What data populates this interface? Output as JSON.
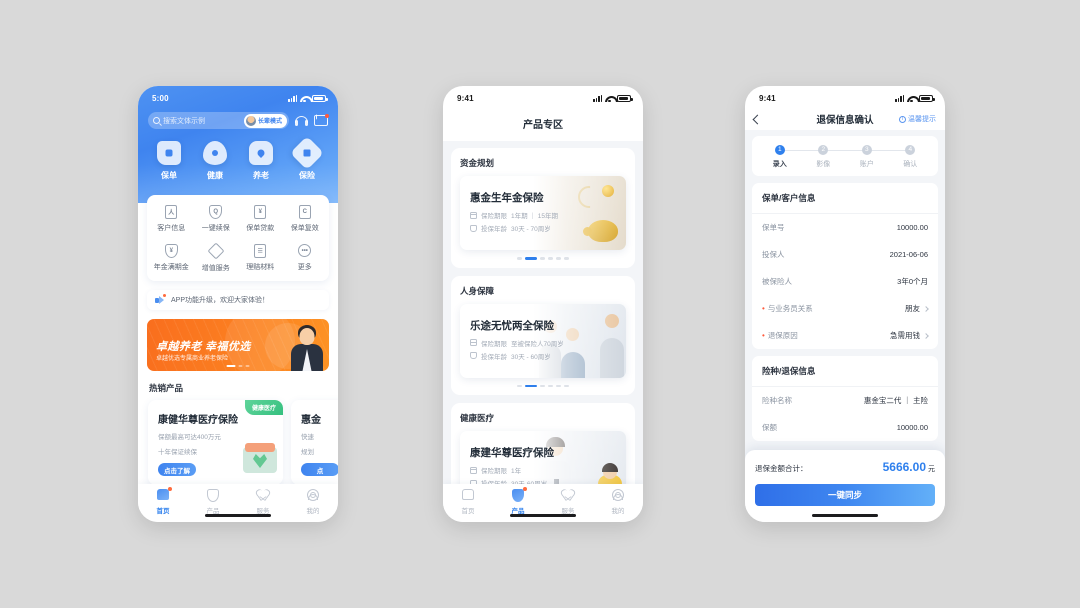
{
  "phone1": {
    "status": {
      "time": "5:00"
    },
    "search": {
      "placeholder": "搜索文体示例",
      "elder_mode": "长辈模式"
    },
    "icons": {
      "headphone": "headphone-icon",
      "mail": "mail-icon",
      "search": "search-icon"
    },
    "topnav": [
      {
        "label": "保单",
        "icon": "policy-icon"
      },
      {
        "label": "健康",
        "icon": "health-drop-icon"
      },
      {
        "label": "养老",
        "icon": "pension-house-icon"
      },
      {
        "label": "保险",
        "icon": "insurance-shield-icon"
      }
    ],
    "grid": [
      {
        "label": "客户信息",
        "icon": "user-card-icon",
        "glyph": "人"
      },
      {
        "label": "一键续保",
        "icon": "renew-shield-icon",
        "glyph": "Q"
      },
      {
        "label": "保单贷款",
        "icon": "loan-doc-icon",
        "glyph": "¥"
      },
      {
        "label": "保单复效",
        "icon": "reinstate-icon",
        "glyph": "C"
      },
      {
        "label": "年金满期金",
        "icon": "annuity-shield-icon",
        "glyph": "¥"
      },
      {
        "label": "增值服务",
        "icon": "value-added-icon",
        "glyph": "◇"
      },
      {
        "label": "理赔材料",
        "icon": "claim-doc-icon",
        "glyph": "☰"
      },
      {
        "label": "更多",
        "icon": "more-icon",
        "glyph": "•••"
      }
    ],
    "notice": {
      "text": "APP功能升级，欢迎大家体验！",
      "icon": "megaphone-icon"
    },
    "banner": {
      "title": "卓越养老 幸福优选",
      "subtitle": "卓越优选专属商业养老保险",
      "accent": "#f97b1f"
    },
    "hot_section_title": "热销产品",
    "hot_products": [
      {
        "badge": "健康医疗",
        "title": "康健华尊医疗保险",
        "line1": "保额最高可达400万元",
        "line2": "十年保证续保",
        "button": "点击了解"
      },
      {
        "badge": "",
        "title": "惠金",
        "line1": "快速",
        "line2": "规划",
        "button": "点"
      }
    ],
    "tabbar": [
      {
        "label": "首页",
        "icon": "home-icon",
        "active": true
      },
      {
        "label": "产品",
        "icon": "product-icon",
        "active": false
      },
      {
        "label": "服务",
        "icon": "service-heart-icon",
        "active": false
      },
      {
        "label": "我的",
        "icon": "profile-icon",
        "active": false
      }
    ]
  },
  "phone2": {
    "status": {
      "time": "9:41"
    },
    "title": "产品专区",
    "sections": [
      {
        "title": "资金规划",
        "card": {
          "name": "惠金生年金保险",
          "line1_label": "保险期限",
          "line1_value": "1年期 ｜ 15年期",
          "line2_label": "投保年龄",
          "line2_value": "30天 - 70周岁",
          "art": "piggy-bank-image"
        },
        "dots": {
          "count": 6,
          "active": 1
        }
      },
      {
        "title": "人身保障",
        "card": {
          "name": "乐途无忧两全保险",
          "line1_label": "保险期限",
          "line1_value": "至被保险人70周岁",
          "line2_label": "投保年龄",
          "line2_value": "30天 - 60周岁",
          "art": "family-photo-image"
        },
        "dots": {
          "count": 6,
          "active": 1
        }
      },
      {
        "title": "健康医疗",
        "card": {
          "name": "康建华尊医疗保险",
          "line1_label": "保险期限",
          "line1_value": "1年",
          "line2_label": "投保年龄",
          "line2_value": "30天-60周岁",
          "art": "doctor-child-image"
        },
        "dots": {
          "count": 6,
          "active": 1
        }
      }
    ],
    "tabbar": [
      {
        "label": "首页",
        "icon": "home-icon",
        "active": false
      },
      {
        "label": "产品",
        "icon": "product-icon",
        "active": true
      },
      {
        "label": "服务",
        "icon": "service-heart-icon",
        "active": false
      },
      {
        "label": "我的",
        "icon": "profile-icon",
        "active": false
      }
    ]
  },
  "phone3": {
    "status": {
      "time": "9:41"
    },
    "navbar": {
      "title": "退保信息确认",
      "back": "back-arrow-icon",
      "tip": "温馨提示"
    },
    "steps": [
      {
        "num": "1",
        "label": "录入",
        "active": true
      },
      {
        "num": "2",
        "label": "影像",
        "active": false
      },
      {
        "num": "3",
        "label": "账户",
        "active": false
      },
      {
        "num": "4",
        "label": "确认",
        "active": false
      }
    ],
    "card1": {
      "title": "保单/客户信息",
      "rows": [
        {
          "key": "保单号",
          "value": "10000.00",
          "required": false,
          "chevron": false
        },
        {
          "key": "投保人",
          "value": "2021-06-06",
          "required": false,
          "chevron": false
        },
        {
          "key": "被保险人",
          "value": "3年0个月",
          "required": false,
          "chevron": false
        },
        {
          "key": "与业务员关系",
          "value": "朋友",
          "required": true,
          "chevron": true
        },
        {
          "key": "退保原因",
          "value": "急需用钱",
          "required": true,
          "chevron": true
        }
      ]
    },
    "card2": {
      "title": "险种/退保信息",
      "rows": [
        {
          "key": "险种名称",
          "value": "惠金宝二代 ｜ 主险",
          "required": false,
          "chevron": false
        },
        {
          "key": "保额",
          "value": "10000.00",
          "required": false,
          "chevron": false
        }
      ]
    },
    "footer": {
      "label": "退保金额合计：",
      "amount": "5666.00",
      "unit": "元",
      "button": "一键同步",
      "accent": "#2f80ed"
    }
  }
}
